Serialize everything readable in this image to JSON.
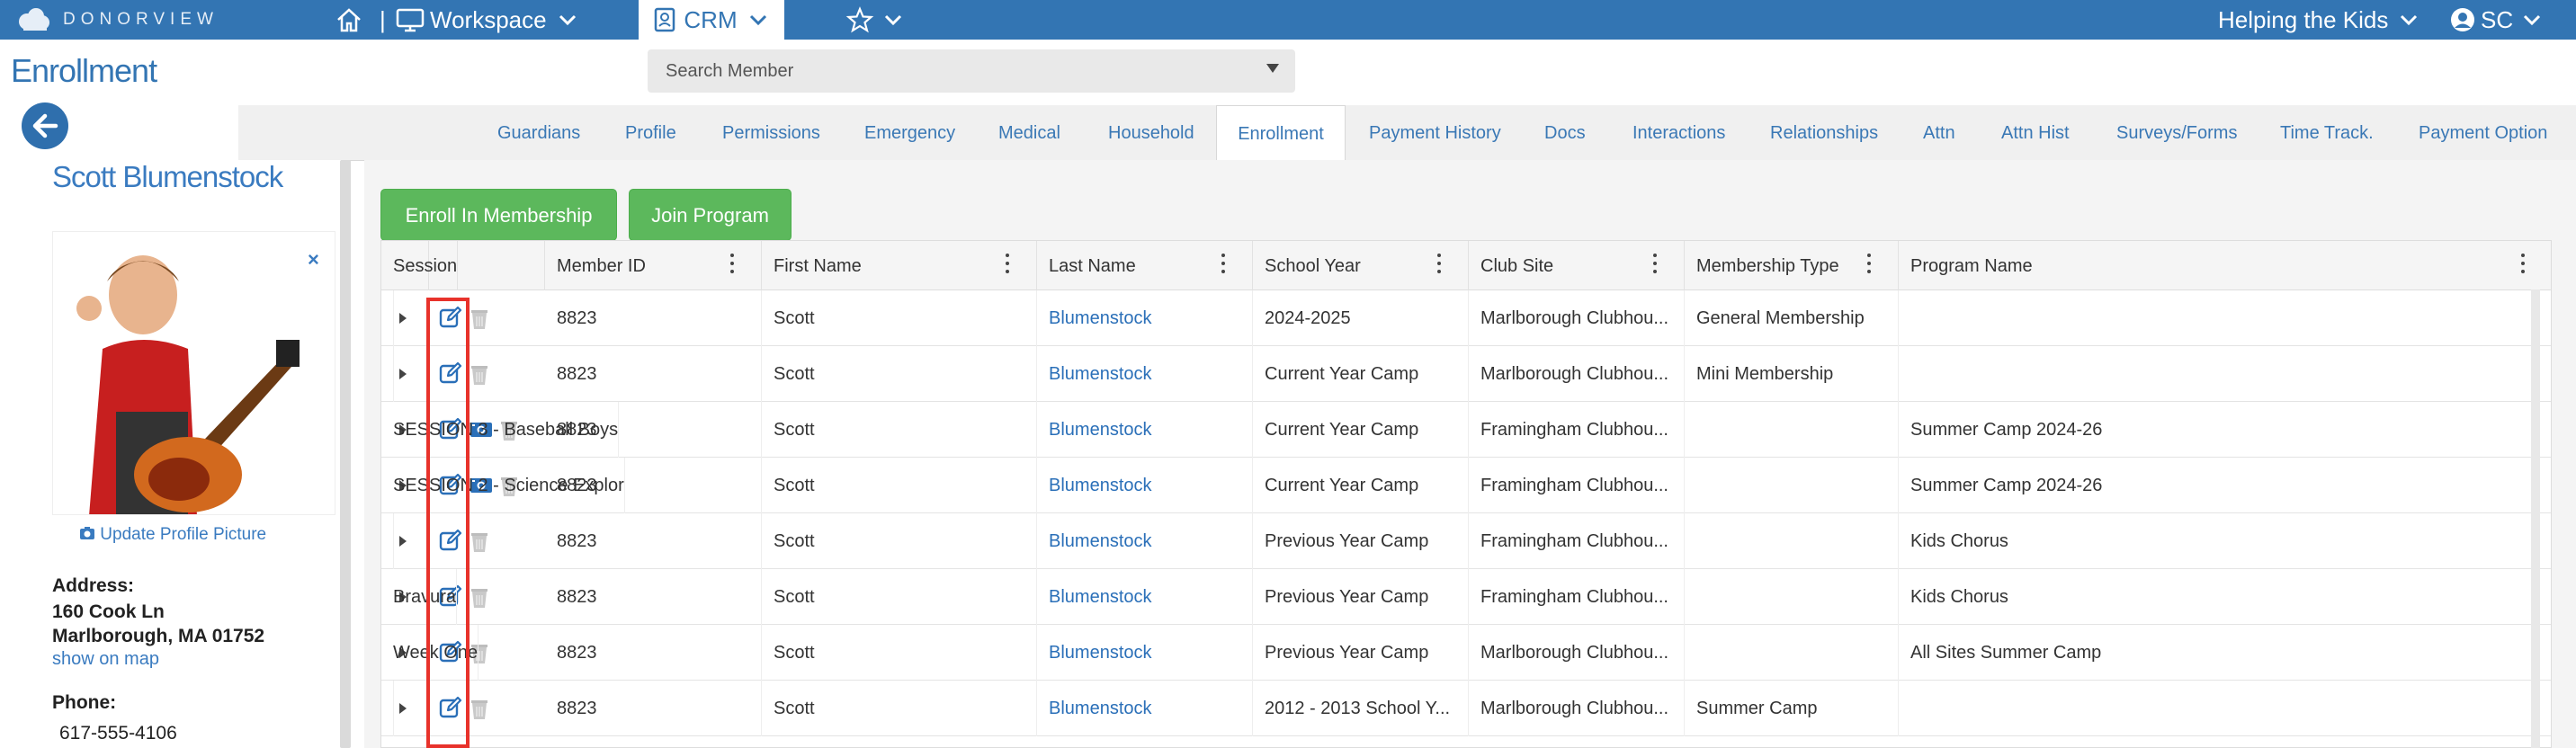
{
  "topbar": {
    "logo_text": "DONORVIEW",
    "workspace_label": "Workspace",
    "crm_label": "CRM",
    "org_label": "Helping the Kids",
    "user_initials": "SC"
  },
  "page": {
    "title": "Enrollment",
    "search_placeholder": "Search Member"
  },
  "tabs": [
    {
      "label": "Guardians"
    },
    {
      "label": "Profile"
    },
    {
      "label": "Permissions"
    },
    {
      "label": "Emergency"
    },
    {
      "label": "Medical"
    },
    {
      "label": "Household"
    },
    {
      "label": "Enrollment",
      "active": true
    },
    {
      "label": "Payment History"
    },
    {
      "label": "Docs"
    },
    {
      "label": "Interactions"
    },
    {
      "label": "Relationships"
    },
    {
      "label": "Attn"
    },
    {
      "label": "Attn Hist"
    },
    {
      "label": "Surveys/Forms"
    },
    {
      "label": "Time Track."
    },
    {
      "label": "Payment Option"
    }
  ],
  "sidebar": {
    "member_name": "Scott Blumenstock",
    "update_picture_label": "Update Profile Picture",
    "address_label": "Address:",
    "address_line1": "160 Cook Ln",
    "address_line2": "Marlborough, MA 01752",
    "map_link": "show on map",
    "phone_label": "Phone:",
    "phone_value": "617-555-4106"
  },
  "actions": {
    "enroll_label": "Enroll In Membership",
    "join_label": "Join Program"
  },
  "grid": {
    "columns": [
      "Member ID",
      "First Name",
      "Last Name",
      "School Year",
      "Club Site",
      "Membership Type",
      "Program Name",
      "Session"
    ],
    "rows": [
      {
        "member_id": "8823",
        "first": "Scott",
        "last": "Blumenstock",
        "school_year": "2024-2025",
        "club_site": "Marlborough Clubhou...",
        "membership_type": "General Membership",
        "program": "",
        "session": "",
        "has_camera": false
      },
      {
        "member_id": "8823",
        "first": "Scott",
        "last": "Blumenstock",
        "school_year": "Current Year Camp",
        "club_site": "Marlborough Clubhou...",
        "membership_type": "Mini Membership",
        "program": "",
        "session": "",
        "has_camera": false
      },
      {
        "member_id": "8823",
        "first": "Scott",
        "last": "Blumenstock",
        "school_year": "Current Year Camp",
        "club_site": "Framingham Clubhou...",
        "membership_type": "",
        "program": "Summer Camp 2024-26",
        "session": "SESSION 3 - Baseball Boys",
        "has_camera": true
      },
      {
        "member_id": "8823",
        "first": "Scott",
        "last": "Blumenstock",
        "school_year": "Current Year Camp",
        "club_site": "Framingham Clubhou...",
        "membership_type": "",
        "program": "Summer Camp 2024-26",
        "session": "SESSION 2 - Science Explor",
        "has_camera": true
      },
      {
        "member_id": "8823",
        "first": "Scott",
        "last": "Blumenstock",
        "school_year": "Previous Year Camp",
        "club_site": "Framingham Clubhou...",
        "membership_type": "",
        "program": "Kids Chorus",
        "session": "",
        "has_camera": false
      },
      {
        "member_id": "8823",
        "first": "Scott",
        "last": "Blumenstock",
        "school_year": "Previous Year Camp",
        "club_site": "Framingham Clubhou...",
        "membership_type": "",
        "program": "Kids Chorus",
        "session": "Bravura",
        "has_camera": false
      },
      {
        "member_id": "8823",
        "first": "Scott",
        "last": "Blumenstock",
        "school_year": "Previous Year Camp",
        "club_site": "Marlborough Clubhou...",
        "membership_type": "",
        "program": "All Sites Summer Camp",
        "session": "Week One",
        "has_camera": false
      },
      {
        "member_id": "8823",
        "first": "Scott",
        "last": "Blumenstock",
        "school_year": "2012 - 2013 School Y...",
        "club_site": "Marlborough Clubhou...",
        "membership_type": "Summer Camp",
        "program": "",
        "session": "",
        "has_camera": false
      }
    ]
  },
  "colors": {
    "brand_blue": "#3375b3",
    "link_blue": "#2a6fb8",
    "button_green": "#5cb85c",
    "highlight_red": "#e8322b"
  }
}
